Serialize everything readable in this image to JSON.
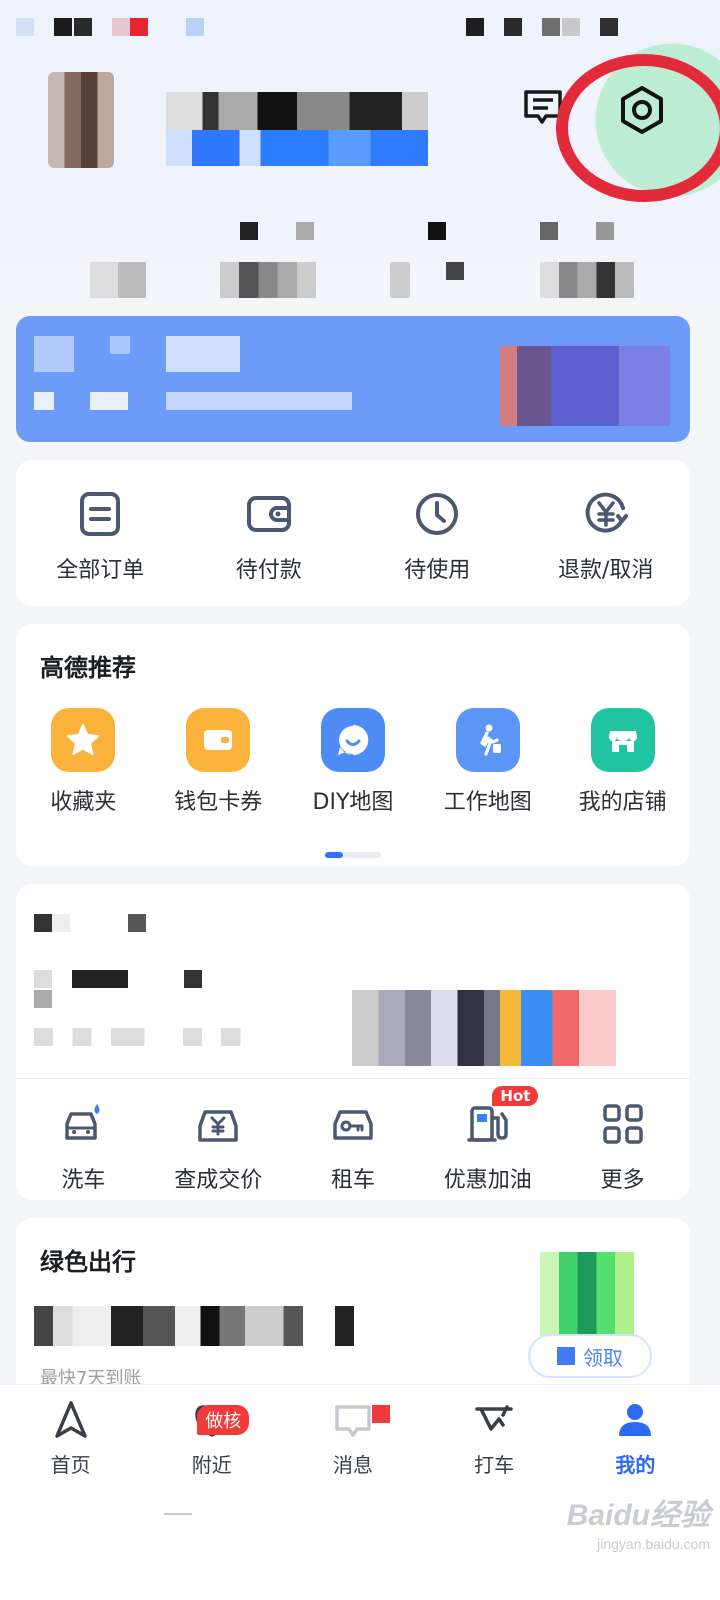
{
  "colors": {
    "accent": "#2b6af2",
    "banner": "#6d9bfa",
    "highlight_ring": "#e22a3a",
    "hot": "#f23a3a",
    "star_tile": "#fbb23a",
    "wallet_tile": "#fbb23a",
    "diy_tile": "#4d8cf5",
    "work_tile": "#5b95f6",
    "shop_tile": "#21c4a0"
  },
  "header": {
    "message_icon": "message-list-icon",
    "settings_icon": "settings-hexagon-icon"
  },
  "orders": {
    "items": [
      {
        "label": "全部订单",
        "icon": "order-list-icon"
      },
      {
        "label": "待付款",
        "icon": "wallet-icon"
      },
      {
        "label": "待使用",
        "icon": "clock-icon"
      },
      {
        "label": "退款/取消",
        "icon": "refund-yen-icon"
      }
    ]
  },
  "recommend": {
    "title": "高德推荐",
    "items": [
      {
        "label": "收藏夹",
        "icon": "star-icon"
      },
      {
        "label": "钱包卡券",
        "icon": "wallet-card-icon"
      },
      {
        "label": "DIY地图",
        "icon": "smile-bubble-icon"
      },
      {
        "label": "工作地图",
        "icon": "walker-icon"
      },
      {
        "label": "我的店铺",
        "icon": "store-icon"
      }
    ]
  },
  "car_services": {
    "items": [
      {
        "label": "洗车",
        "icon": "car-wash-icon"
      },
      {
        "label": "查成交价",
        "icon": "car-price-icon"
      },
      {
        "label": "租车",
        "icon": "car-rental-icon"
      },
      {
        "label": "优惠加油",
        "icon": "fuel-pump-icon",
        "badge": "Hot"
      },
      {
        "label": "更多",
        "icon": "grid-more-icon"
      }
    ]
  },
  "green_travel": {
    "title": "绿色出行",
    "subtitle_partial": "最快7天到账",
    "button_label": "领取"
  },
  "tabbar": {
    "items": [
      {
        "label": "首页",
        "icon": "navigate-arrow-icon",
        "active": false
      },
      {
        "label": "附近",
        "icon": "heart-location-icon",
        "active": false,
        "badge": "做核"
      },
      {
        "label": "消息",
        "icon": "message-icon",
        "active": false
      },
      {
        "label": "打车",
        "icon": "taxi-icon",
        "active": false
      },
      {
        "label": "我的",
        "icon": "user-icon",
        "active": true
      }
    ]
  },
  "watermark": {
    "line1": "Baidu经验",
    "line2": "jingyan.baidu.com"
  }
}
